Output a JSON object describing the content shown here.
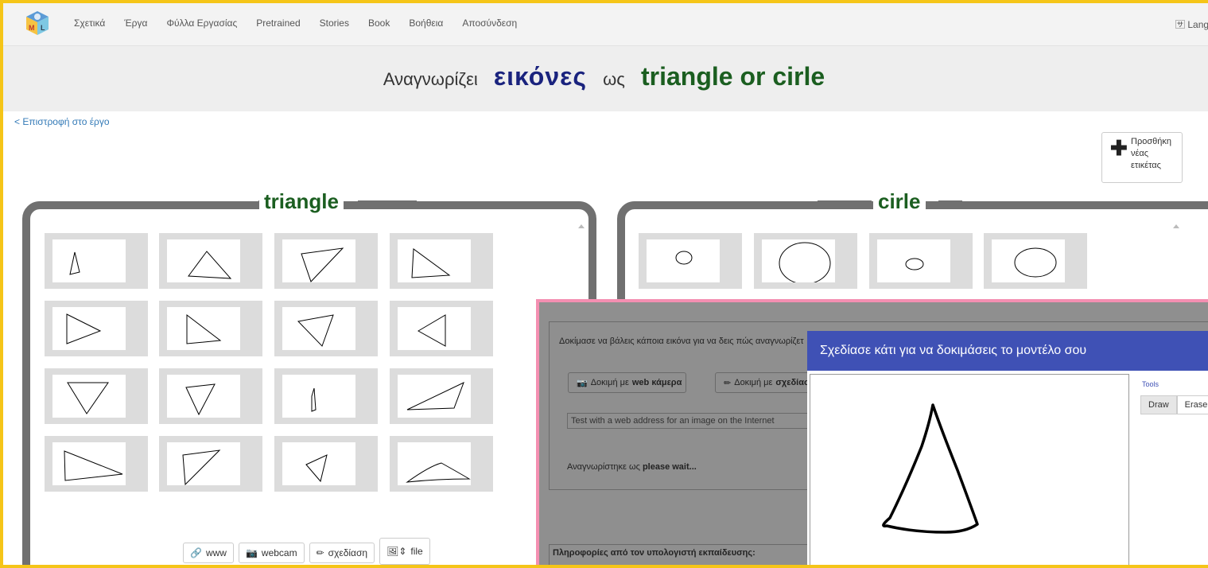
{
  "nav": {
    "items": [
      "Σχετικά",
      "Έργα",
      "Φύλλα Εργασίας",
      "Pretrained",
      "Stories",
      "Book",
      "Βοήθεια",
      "Αποσύνδεση"
    ],
    "language": "Language"
  },
  "header": {
    "prefix": "Αναγνωρίζει",
    "type": "εικόνες",
    "middle": "ως",
    "labels": "triangle or cirle"
  },
  "back_link": "< Επιστροφή στο έργο",
  "add_label": "Προσθήκη νέας ετικέτας",
  "buckets": [
    {
      "name": "triangle"
    },
    {
      "name": "cirle"
    }
  ],
  "bucket_buttons": {
    "www": "www",
    "webcam": "webcam",
    "draw": "σχεδίαση",
    "file": "file"
  },
  "test_panel": {
    "intro": "Δοκίμασε να βάλεις κάποια εικόνα για να δεις πώς αναγνωρίζετ",
    "webcam_prefix": "Δοκιμή με ",
    "webcam_bold": "web κάμερα",
    "draw_prefix": "Δοκιμή με ",
    "draw_bold": "σχεδίασ",
    "url_placeholder": "Test with a web address for an image on the Internet",
    "recognised_prefix": "Αναγνωρίστηκε ως ",
    "recognised_value": "please wait...",
    "info": "Πληροφορίες από τον υπολογιστή εκπαίδευσης:"
  },
  "draw_dialog": {
    "title": "Σχεδίασε κάτι για να δοκιμάσεις το μοντέλο σου",
    "tools_label": "Tools",
    "draw": "Draw",
    "erase": "Erase"
  },
  "colors": {
    "accent": "#3f51b5",
    "label_green": "#1b5e20",
    "keyword_blue": "#1a237e",
    "frame_yellow": "#f5c518",
    "frame_pink": "#f48fb1"
  }
}
